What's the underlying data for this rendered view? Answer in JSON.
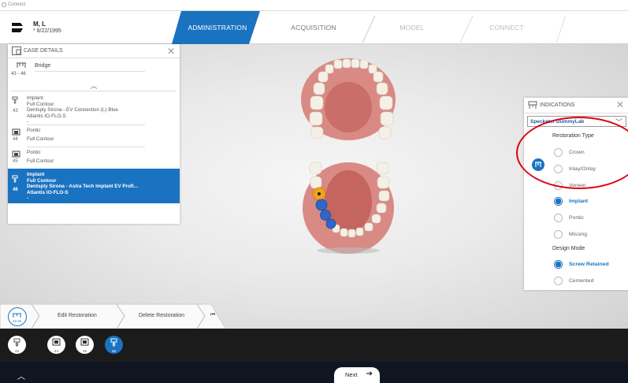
{
  "window": {
    "title": "Connect"
  },
  "patient": {
    "name": "M, L",
    "dob": "* 8/22/1995"
  },
  "tabs": [
    {
      "label": "ADMINISTRATION",
      "state": "active"
    },
    {
      "label": "ACQUISITION",
      "state": "inactive"
    },
    {
      "label": "MODEL",
      "state": "disabled"
    },
    {
      "label": "CONNECT",
      "state": "disabled"
    }
  ],
  "case_details": {
    "title": "CASE DETAILS",
    "bridge_label": "Bridge",
    "bridge_range": "43 - 46",
    "items": [
      {
        "tooth": "43",
        "lines": [
          "Implant",
          "Full Contour",
          "Dentsply Sirona - EV Connection (L) Blue",
          "Atlantis IO-FLO-S",
          "-"
        ],
        "icon": "implant-icon",
        "selected": false
      },
      {
        "tooth": "44",
        "lines": [
          "Pontic",
          "Full Contour"
        ],
        "icon": "pontic-icon",
        "selected": false
      },
      {
        "tooth": "45",
        "lines": [
          "Pontic",
          "Full Contour"
        ],
        "icon": "pontic-icon",
        "selected": false
      },
      {
        "tooth": "46",
        "lines": [
          "Implant",
          "Full Contour",
          "Dentsply Sirona - Astra Tech Implant EV Profi...",
          "Atlantis IO-FLO-S",
          "-"
        ],
        "icon": "implant-icon",
        "selected": true
      }
    ]
  },
  "indications": {
    "title": "INDICATIONS",
    "lab": "Specketer DummyLab",
    "restoration_type_label": "Restoration Type",
    "restoration_options": [
      {
        "label": "Crown",
        "selected": false
      },
      {
        "label": "Inlay/Onlay",
        "selected": false
      },
      {
        "label": "Veneer",
        "selected": false
      },
      {
        "label": "Implant",
        "selected": true
      },
      {
        "label": "Pontic",
        "selected": false
      },
      {
        "label": "Missing",
        "selected": false
      }
    ],
    "design_mode_label": "Design Mode",
    "design_options": [
      {
        "label": "Screw Retained",
        "selected": true
      },
      {
        "label": "Cemented",
        "selected": false
      }
    ]
  },
  "toolbar": {
    "bridge_range": "43-46",
    "edit": "Edit Restoration",
    "delete": "Delete Restoration"
  },
  "teeth": [
    {
      "num": "43",
      "selected": false
    },
    {
      "num": "44",
      "selected": false
    },
    {
      "num": "45",
      "selected": false
    },
    {
      "num": "46",
      "selected": true
    }
  ],
  "footer": {
    "next": "Next"
  },
  "colors": {
    "accent": "#1a73c1",
    "annotation": "#e00012",
    "dark_bar": "#1b1b1b"
  }
}
